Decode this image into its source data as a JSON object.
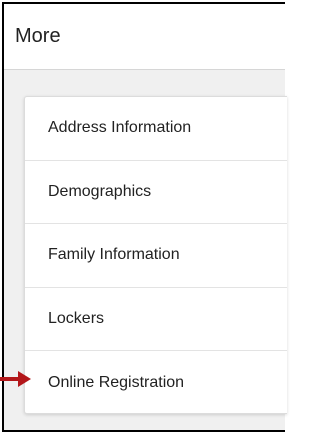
{
  "header": {
    "title": "More"
  },
  "menu": {
    "items": [
      {
        "label": "Address Information"
      },
      {
        "label": "Demographics"
      },
      {
        "label": "Family Information"
      },
      {
        "label": "Lockers"
      },
      {
        "label": "Online Registration"
      }
    ]
  },
  "colors": {
    "arrow": "#b3171a"
  }
}
